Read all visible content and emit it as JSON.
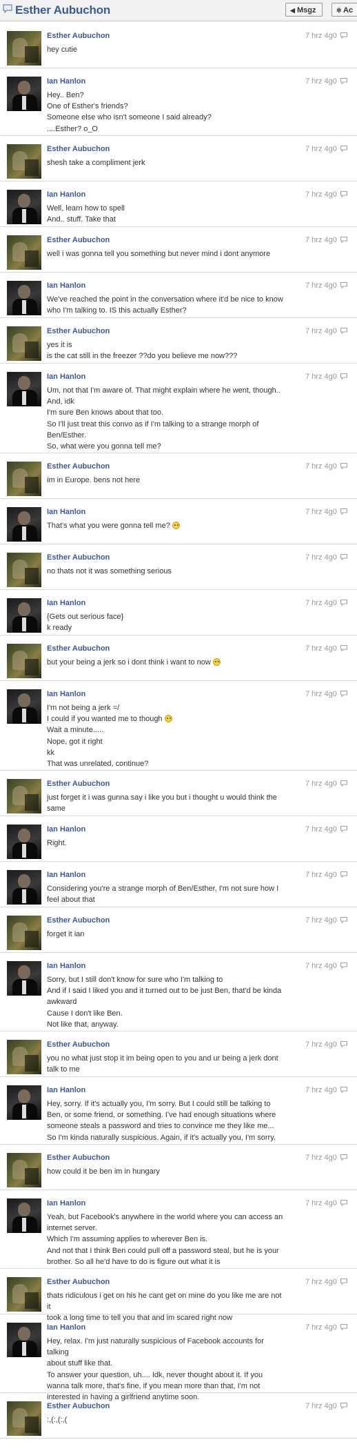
{
  "header": {
    "title": "Esther Aubuchon",
    "buttons": [
      {
        "label": "Msgz",
        "icon": "left-arrow-icon"
      },
      {
        "label": "Ac",
        "icon": "gear-icon"
      }
    ]
  },
  "messages": [
    {
      "author": "Esther Aubuchon",
      "avatar": "esther",
      "time": "7 hrz 4g0",
      "lines": [
        {
          "text": "hey cutie"
        }
      ]
    },
    {
      "author": "Ian Hanlon",
      "avatar": "ian",
      "time": "7 hrz 4g0",
      "lines": [
        {
          "text": "Hey.. Ben?"
        },
        {
          "text": "One of Esther's friends?"
        },
        {
          "text": "Someone else who isn't someone I said already?"
        },
        {
          "text": "....Esther? o_O"
        }
      ]
    },
    {
      "author": "Esther Aubuchon",
      "avatar": "esther",
      "time": "7 hrz 4g0",
      "lines": [
        {
          "text": "shesh take a compliment jerk"
        }
      ]
    },
    {
      "author": "Ian Hanlon",
      "avatar": "ian",
      "time": "7 hrz 4g0",
      "lines": [
        {
          "text": "Well, learn how to spell"
        },
        {
          "text": "And.. stuff. Take that"
        }
      ]
    },
    {
      "author": "Esther Aubuchon",
      "avatar": "esther",
      "time": "7 hrz 4g0",
      "lines": [
        {
          "text": "well i was gonna tell you something but never mind i dont anymore"
        }
      ]
    },
    {
      "author": "Ian Hanlon",
      "avatar": "ian",
      "time": "7 hrz 4g0",
      "lines": [
        {
          "text": "We've reached the point in the conversation where it'd be nice to know"
        },
        {
          "text": "who I'm talking to. IS this actually Esther?"
        }
      ]
    },
    {
      "author": "Esther Aubuchon",
      "avatar": "esther",
      "time": "7 hrz 4g0",
      "lines": [
        {
          "text": "yes it is"
        },
        {
          "text": "is the cat still in the freezer ??do you believe me now???"
        }
      ]
    },
    {
      "author": "Ian Hanlon",
      "avatar": "ian",
      "time": "7 hrz 4g0",
      "lines": [
        {
          "text": "Um, not that I'm aware of. That might explain where he went, though.."
        },
        {
          "text": "And, idk"
        },
        {
          "text": "I'm sure Ben knows about that too."
        },
        {
          "text": "So I'll just treat this convo as if I'm talking to a strange morph of"
        },
        {
          "text": "Ben/Esther."
        },
        {
          "text": "So, what were you gonna tell me?"
        }
      ]
    },
    {
      "author": "Esther Aubuchon",
      "avatar": "esther",
      "time": "7 hrz 4g0",
      "lines": [
        {
          "text": "im in Europe. bens not here"
        }
      ]
    },
    {
      "author": "Ian Hanlon",
      "avatar": "ian",
      "time": "7 hrz 4g0",
      "lines": [
        {
          "text": "That's what you were gonna tell me?",
          "emoji": "wink-face-icon"
        }
      ]
    },
    {
      "author": "Esther Aubuchon",
      "avatar": "esther",
      "time": "7 hrz 4g0",
      "lines": [
        {
          "text": "no thats not it was something serious"
        }
      ]
    },
    {
      "author": "Ian Hanlon",
      "avatar": "ian",
      "time": "7 hrz 4g0",
      "lines": [
        {
          "text": "{Gets out serious face}"
        },
        {
          "text": "k ready"
        }
      ]
    },
    {
      "author": "Esther Aubuchon",
      "avatar": "esther",
      "time": "7 hrz 4g0",
      "lines": [
        {
          "text": "but your being a jerk so i dont think i want to now",
          "emoji": "unsure-face-icon"
        }
      ]
    },
    {
      "author": "Ian Hanlon",
      "avatar": "ian",
      "time": "7 hrz 4g0",
      "lines": [
        {
          "text": "I'm not being a jerk =/"
        },
        {
          "text": "I could if you wanted me to though",
          "emoji": "unsure-face-icon"
        },
        {
          "text": "Wait a minute....."
        },
        {
          "text": "Nope, got it right"
        },
        {
          "text": "kk"
        },
        {
          "text": "That was unrelated, continue?"
        }
      ]
    },
    {
      "author": "Esther Aubuchon",
      "avatar": "esther",
      "time": "7 hrz 4g0",
      "lines": [
        {
          "text": "just forget it i was gunna say i like you but i thought u would think the"
        },
        {
          "text": "same"
        }
      ]
    },
    {
      "author": "Ian Hanlon",
      "avatar": "ian",
      "time": "7 hrz 4g0",
      "lines": [
        {
          "text": "Right."
        }
      ]
    },
    {
      "author": "Ian Hanlon",
      "avatar": "ian",
      "time": "7 hrz 4g0",
      "lines": [
        {
          "text": "Considering you're a strange morph of Ben/Esther, I'm not sure how I"
        },
        {
          "text": "feel about that"
        }
      ]
    },
    {
      "author": "Esther Aubuchon",
      "avatar": "esther",
      "time": "7 hrz 4g0",
      "lines": [
        {
          "text": "forget it ian"
        }
      ]
    },
    {
      "author": "Ian Hanlon",
      "avatar": "ian",
      "time": "7 hrz 4g0",
      "lines": [
        {
          "text": "Sorry, but I still don't know for sure who I'm talking to"
        },
        {
          "text": "And if I said I liked you and it turned out to be just Ben, that'd be kinda"
        },
        {
          "text": "awkward"
        },
        {
          "text": "Cause I don't like Ben."
        },
        {
          "text": "Not like that, anyway."
        }
      ]
    },
    {
      "author": "Esther Aubuchon",
      "avatar": "esther",
      "time": "7 hrz 4g0",
      "lines": [
        {
          "text": "you no what just stop it im being open to you and ur being a jerk dont"
        },
        {
          "text": "talk to me"
        }
      ]
    },
    {
      "author": "Ian Hanlon",
      "avatar": "ian",
      "time": "7 hrz 4g0",
      "lines": [
        {
          "text": "Hey, sorry. If it's actually you, I'm sorry. But I could still be talking to"
        },
        {
          "text": "Ben, or some friend, or something. I've had enough situations where"
        },
        {
          "text": "someone steals a password and tries to convince me they like me..."
        },
        {
          "text": "So I'm kinda naturally suspicious. Again, if it's actually you, I'm sorry."
        }
      ]
    },
    {
      "author": "Esther Aubuchon",
      "avatar": "esther",
      "time": "7 hrz 4g0",
      "lines": [
        {
          "text": "how could it be ben im in hungary"
        }
      ]
    },
    {
      "author": "Ian Hanlon",
      "avatar": "ian",
      "time": "7 hrz 4g0",
      "lines": [
        {
          "text": "Yeah, but Facebook's anywhere in the world where you can access an"
        },
        {
          "text": "internet server."
        },
        {
          "text": "Which I'm assuming applies to wherever Ben is."
        },
        {
          "text": "And not that I think Ben could pull off a password steal, but he is your"
        },
        {
          "text": "brother. So all he'd have to do is figure out what it is"
        }
      ]
    },
    {
      "author": "Esther Aubuchon",
      "avatar": "esther",
      "time": "7 hrz 4g0",
      "lines": [
        {
          "text": "thats ridiculous i get on his he cant get on mine do you like me are not it"
        },
        {
          "text": "took a long time to tell you that and im scared right now"
        }
      ]
    },
    {
      "author": "Ian Hanlon",
      "avatar": "ian",
      "time": "7 hrz 4g0",
      "lines": [
        {
          "text": "Hey, relax. I'm just naturally suspicious of Facebook accounts for talking"
        },
        {
          "text": "about stuff like that."
        },
        {
          "text": "To answer your question, uh.... Idk, never thought about it. If you"
        },
        {
          "text": "wanna talk more, that's fine, if you mean more than that, I'm not"
        },
        {
          "text": "interested in having a girlfriend anytime soon."
        }
      ]
    },
    {
      "author": "Esther Aubuchon",
      "avatar": "esther",
      "time": "7 hrz 4g0",
      "lines": [
        {
          "text": ":,(:,(:,("
        }
      ]
    }
  ]
}
